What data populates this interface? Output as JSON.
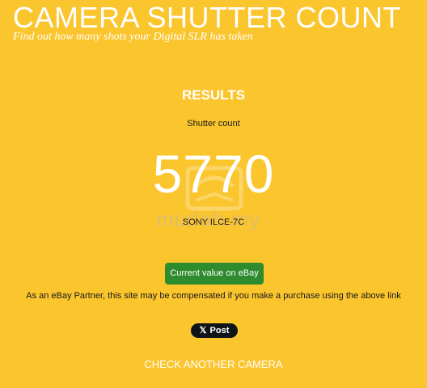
{
  "header": {
    "title": "CAMERA SHUTTER COUNT",
    "tagline": "Find out how many shots your Digital SLR has taken"
  },
  "results": {
    "heading": "RESULTS",
    "shutter_label": "Shutter count",
    "shutter_value": "5770",
    "camera_model": "SONY ILCE-7C"
  },
  "ebay": {
    "button_label": "Current value on eBay",
    "disclaimer": "As an eBay Partner, this site may be compensated if you make a purchase using the above link"
  },
  "social": {
    "post_label": "Post",
    "post_icon": "x-logo-icon"
  },
  "footer": {
    "check_another_label": "CHECK ANOTHER CAMERA"
  },
  "watermark": {
    "text": "mudah.my",
    "icon": "mudah-logo-icon"
  },
  "colors": {
    "background": "#FBC52E",
    "ebay_button": "#2E8B2E",
    "post_button": "#0f1419",
    "text_light": "#ffffff",
    "text_dark": "#1a1a1a"
  }
}
